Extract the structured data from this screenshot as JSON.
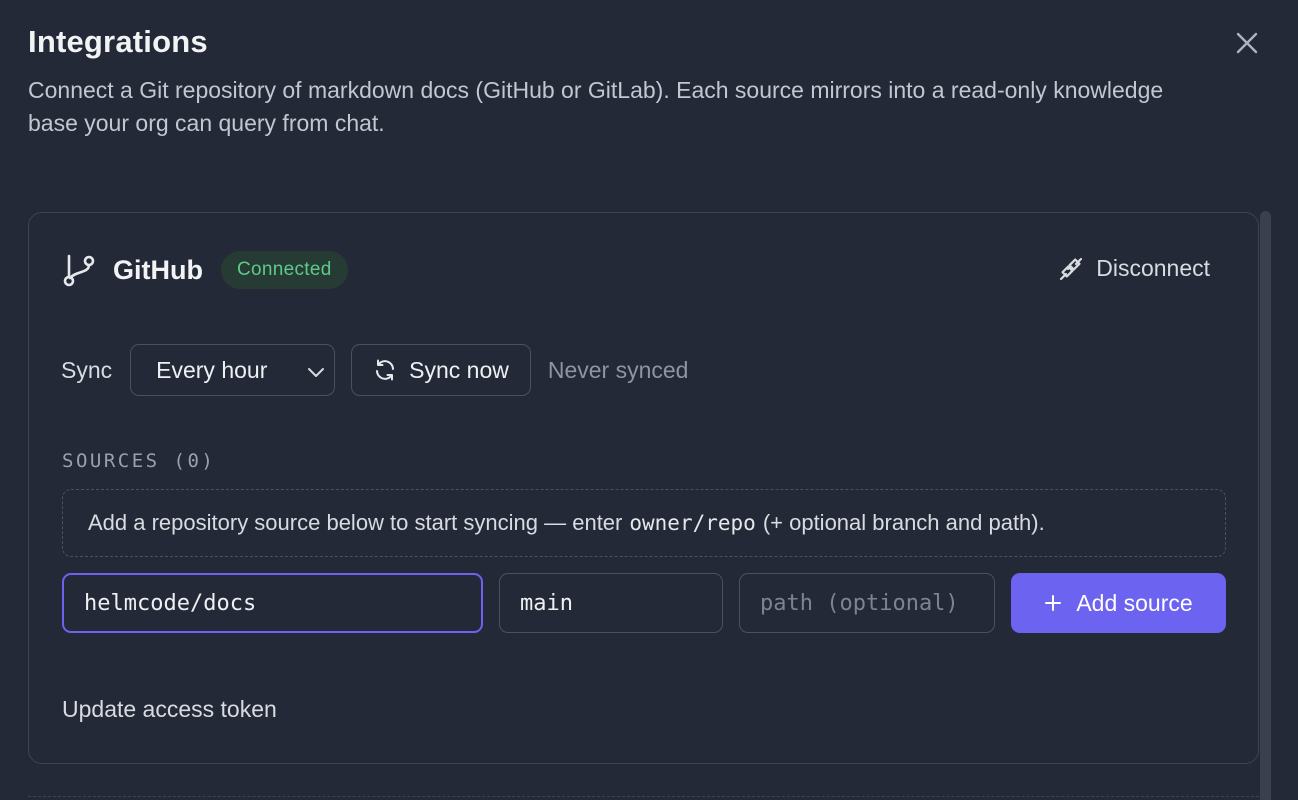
{
  "dialog": {
    "title": "Integrations",
    "description": "Connect a Git repository of markdown docs (GitHub or GitLab). Each source mirrors into a read-only knowledge base your org can query from chat.",
    "close_icon": "close-icon"
  },
  "provider": {
    "icon": "git-branch-icon",
    "name": "GitHub",
    "status": "Connected",
    "disconnect_icon": "unplug-icon",
    "disconnect_label": "Disconnect"
  },
  "sync": {
    "label": "Sync",
    "frequency": "Every hour",
    "sync_now_icon": "refresh-icon",
    "sync_now_label": "Sync now",
    "last_synced": "Never synced"
  },
  "sources": {
    "heading": "SOURCES (0)",
    "empty_prefix": "Add a repository source below to start syncing — enter",
    "empty_code": "owner/repo",
    "empty_suffix": "(+ optional branch and path).",
    "repo_value": "helmcode/docs",
    "branch_value": "main",
    "path_placeholder": "path (optional)",
    "add_icon": "plus-icon",
    "add_label": "Add source"
  },
  "footer": {
    "update_token_label": "Update access token"
  },
  "colors": {
    "background": "#232936",
    "accent": "#6c63f0",
    "connected_text": "#5fc98a",
    "connected_bg": "#263b34"
  }
}
